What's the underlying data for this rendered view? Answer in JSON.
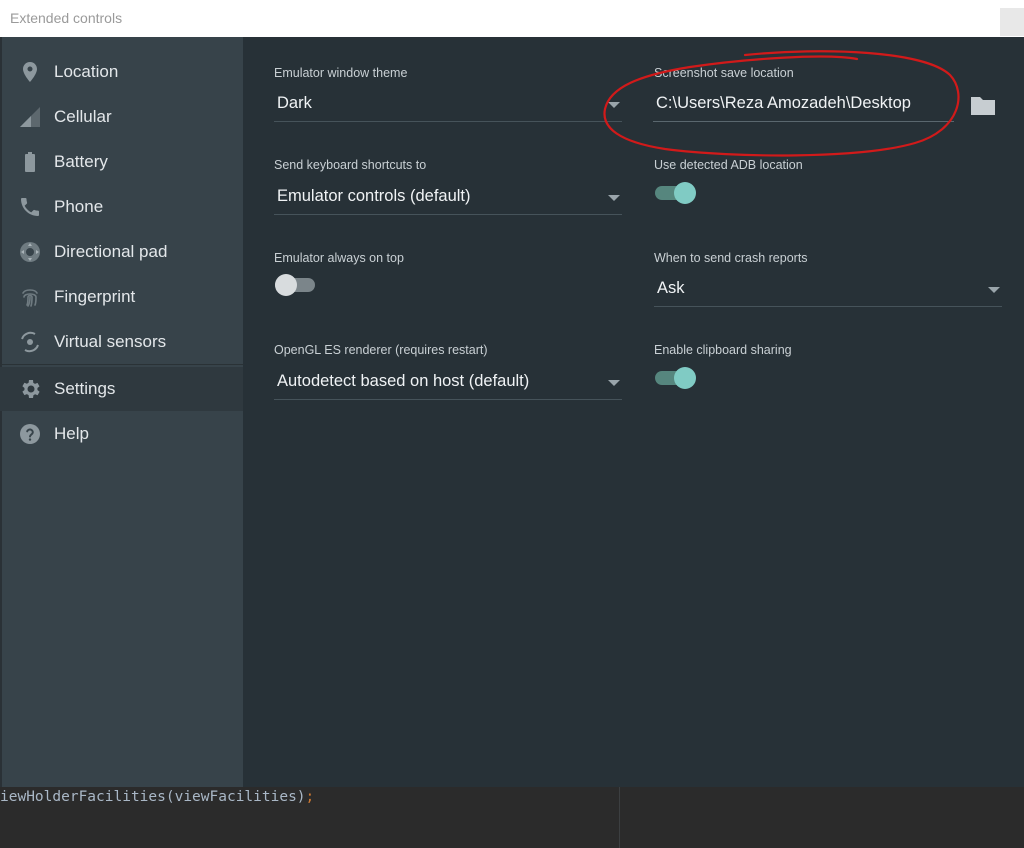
{
  "window": {
    "title": "Extended controls"
  },
  "sidebar": {
    "items": [
      {
        "label": "Location",
        "icon": "location-pin-icon"
      },
      {
        "label": "Cellular",
        "icon": "cellular-signal-icon"
      },
      {
        "label": "Battery",
        "icon": "battery-icon"
      },
      {
        "label": "Phone",
        "icon": "phone-icon"
      },
      {
        "label": "Directional pad",
        "icon": "dpad-icon"
      },
      {
        "label": "Fingerprint",
        "icon": "fingerprint-icon"
      },
      {
        "label": "Virtual sensors",
        "icon": "rotate-sensor-icon"
      },
      {
        "label": "Settings",
        "icon": "gear-icon",
        "active": true
      },
      {
        "label": "Help",
        "icon": "help-icon"
      }
    ]
  },
  "settings": {
    "theme": {
      "label": "Emulator window theme",
      "value": "Dark"
    },
    "screenshot": {
      "label": "Screenshot save location",
      "value": "C:\\Users\\Reza Amozadeh\\Desktop"
    },
    "shortcuts": {
      "label": "Send keyboard shortcuts to",
      "value": "Emulator controls (default)"
    },
    "adb": {
      "label": "Use detected ADB location",
      "enabled": true
    },
    "on_top": {
      "label": "Emulator always on top",
      "enabled": false
    },
    "crash": {
      "label": "When to send crash reports",
      "value": "Ask"
    },
    "opengl": {
      "label": "OpenGL ES renderer (requires restart)",
      "value": "Autodetect based on host (default)"
    },
    "clipboard": {
      "label": "Enable clipboard sharing",
      "enabled": true
    }
  },
  "colors": {
    "accent_on": "#80cbc4",
    "sidebar_bg": "#37434a",
    "content_bg": "#273137",
    "annotation": "#d11a1a"
  },
  "code_pane": {
    "text": "iewHolderFacilities(viewFacilities)",
    "suffix": ";"
  }
}
